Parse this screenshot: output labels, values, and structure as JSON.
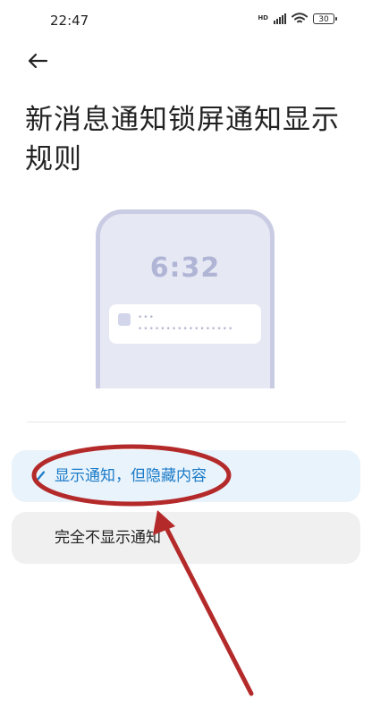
{
  "status_bar": {
    "time": "22:47",
    "hd_label": "HD",
    "battery": "30"
  },
  "header": {
    "back_icon": "arrow-left-icon",
    "title": "新消息通知锁屏通知显示规则"
  },
  "illustration": {
    "time": "6:32",
    "dots_short": "•••",
    "dots_long": "•••••••••••••••••"
  },
  "options": [
    {
      "label": "显示通知，但隐藏内容",
      "selected": true
    },
    {
      "label": "完全不显示通知",
      "selected": false
    }
  ],
  "colors": {
    "accent": "#1b7bc8",
    "selected_bg": "#e9f3fb",
    "annotation_red": "#b42a2a"
  }
}
